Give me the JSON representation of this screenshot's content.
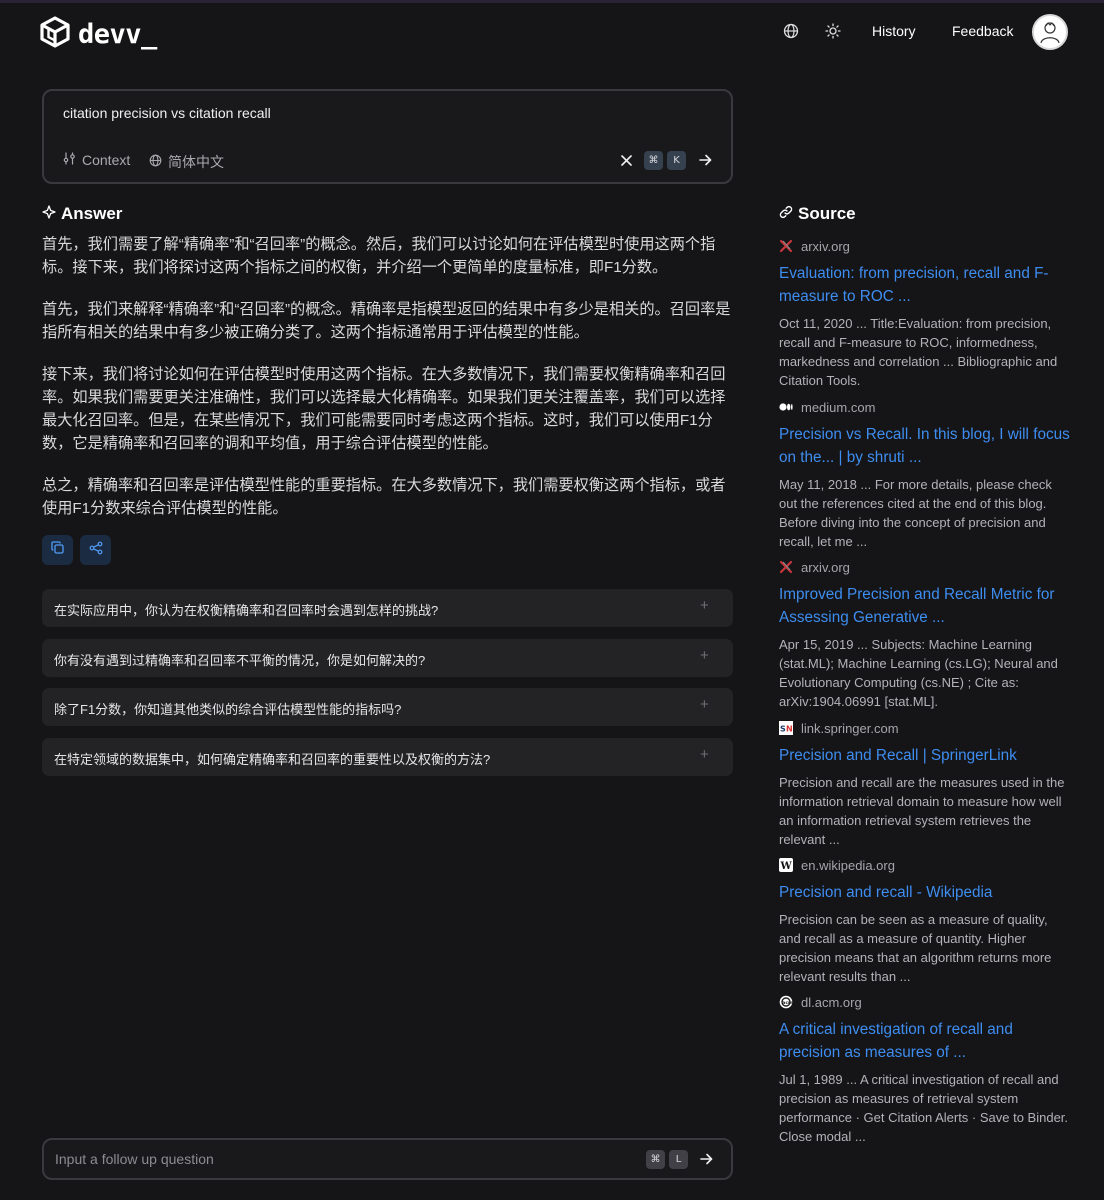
{
  "header": {
    "brand": "devv_",
    "history_label": "History",
    "feedback_label": "Feedback"
  },
  "search": {
    "query": "citation precision vs citation recall",
    "context_label": "Context",
    "language_label": "简体中文",
    "shortcut_mod": "⌘",
    "shortcut_key": "K"
  },
  "answer": {
    "title": "Answer",
    "paragraphs": [
      "首先，我们需要了解“精确率”和“召回率”的概念。然后，我们可以讨论如何在评估模型时使用这两个指标。接下来，我们将探讨这两个指标之间的权衡，并介绍一个更简单的度量标准，即F1分数。",
      "首先，我们来解释“精确率”和“召回率”的概念。精确率是指模型返回的结果中有多少是相关的。召回率是指所有相关的结果中有多少被正确分类了。这两个指标通常用于评估模型的性能。",
      "接下来，我们将讨论如何在评估模型时使用这两个指标。在大多数情况下，我们需要权衡精确率和召回率。如果我们需要更关注准确性，我们可以选择最大化精确率。如果我们更关注覆盖率，我们可以选择最大化召回率。但是，在某些情况下，我们可能需要同时考虑这两个指标。这时，我们可以使用F1分数，它是精确率和召回率的调和平均值，用于综合评估模型的性能。",
      "总之，精确率和召回率是评估模型性能的重要指标。在大多数情况下，我们需要权衡这两个指标，或者使用F1分数来综合评估模型的性能。"
    ]
  },
  "suggestions": [
    "在实际应用中，你认为在权衡精确率和召回率时会遇到怎样的挑战?",
    "你有没有遇到过精确率和召回率不平衡的情况，你是如何解决的?",
    "除了F1分数，你知道其他类似的综合评估模型性能的指标吗?",
    "在特定领域的数据集中，如何确定精确率和召回率的重要性以及权衡的方法?"
  ],
  "followup": {
    "placeholder": "Input a follow up question",
    "shortcut_mod": "⌘",
    "shortcut_key": "L"
  },
  "sources": {
    "title": "Source",
    "items": [
      {
        "domain": "arxiv.org",
        "icon": "arxiv-icon",
        "title": "Evaluation: from precision, recall and F-measure to ROC ...",
        "snippet": "Oct 11, 2020 ... Title:Evaluation: from precision, recall and F-measure to ROC, informedness, markedness and correlation ... Bibliographic and Citation Tools."
      },
      {
        "domain": "medium.com",
        "icon": "medium-icon",
        "title": "Precision vs Recall. In this blog, I will focus on the... | by shruti ...",
        "snippet": "May 11, 2018 ... For more details, please check out the references cited at the end of this blog. Before diving into the concept of precision and recall, let me ..."
      },
      {
        "domain": "arxiv.org",
        "icon": "arxiv-icon",
        "title": "Improved Precision and Recall Metric for Assessing Generative ...",
        "snippet": "Apr 15, 2019 ... Subjects: Machine Learning (stat.ML); Machine Learning (cs.LG); Neural and Evolutionary Computing (cs.NE) ; Cite as: arXiv:1904.06991 [stat.ML]."
      },
      {
        "domain": "link.springer.com",
        "icon": "springer-icon",
        "title": "Precision and Recall | SpringerLink",
        "snippet": "Precision and recall are the measures used in the information retrieval domain to measure how well an information retrieval system retrieves the relevant ..."
      },
      {
        "domain": "en.wikipedia.org",
        "icon": "wikipedia-icon",
        "title": "Precision and recall - Wikipedia",
        "snippet": "Precision can be seen as a measure of quality, and recall as a measure of quantity. Higher precision means that an algorithm returns more relevant results than ..."
      },
      {
        "domain": "dl.acm.org",
        "icon": "acm-icon",
        "title": "A critical investigation of recall and precision as measures of ...",
        "snippet": "Jul 1, 1989 ... A critical investigation of recall and precision as measures of retrieval system performance · Get Citation Alerts · Save to Binder. Close modal ..."
      }
    ]
  },
  "colors": {
    "background": "#151517",
    "link": "#3e8df0",
    "action_button": "#1b2c42"
  }
}
